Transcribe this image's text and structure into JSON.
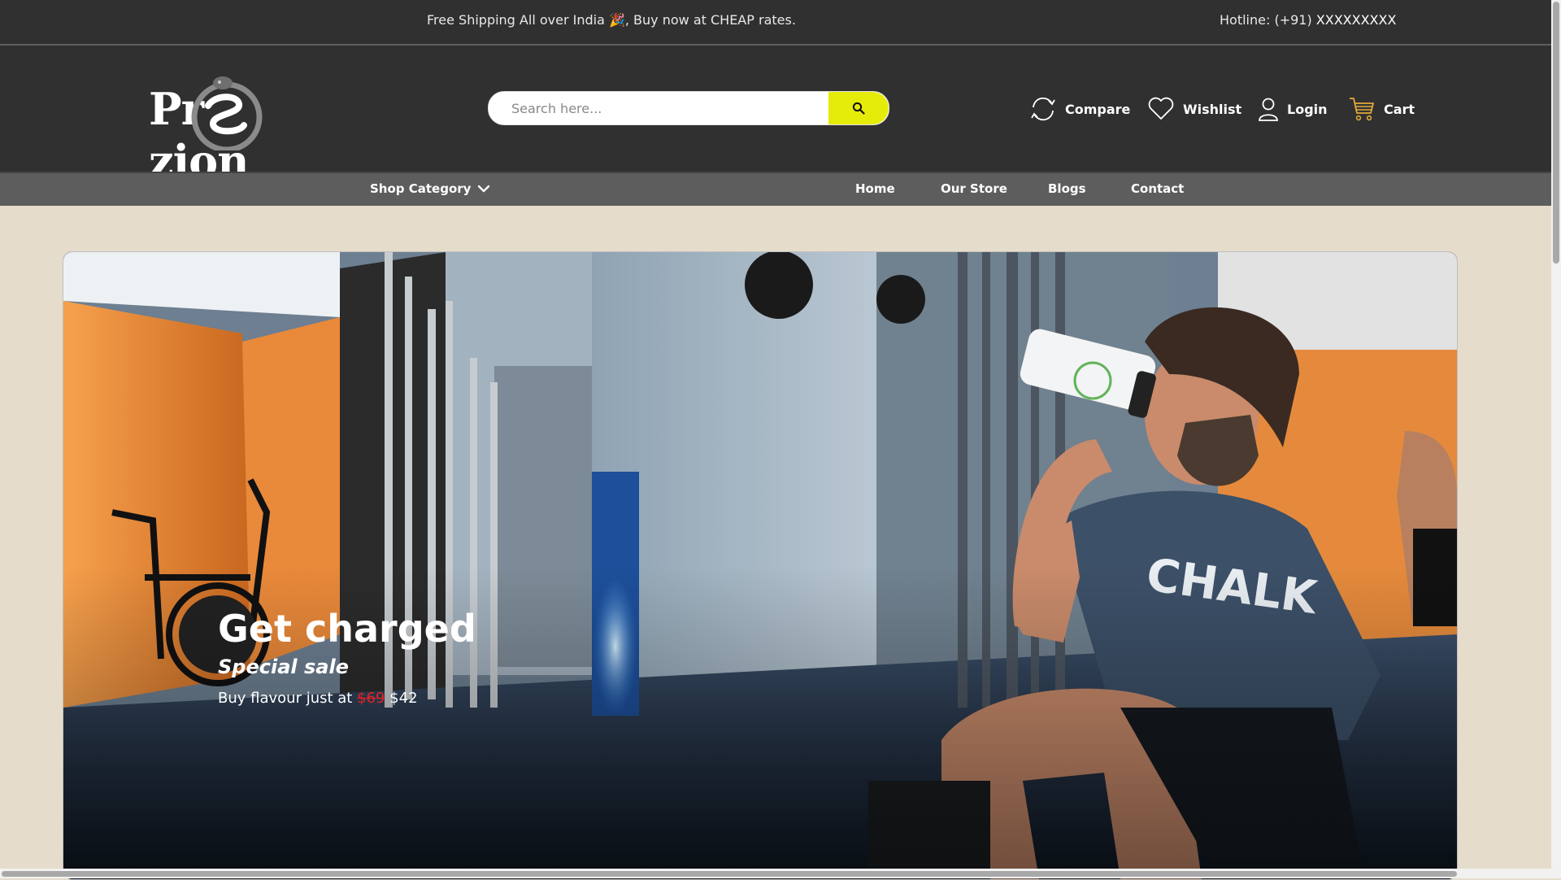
{
  "topbar": {
    "shipping_text": "Free Shipping All over India 🎉, Buy now at CHEAP rates.",
    "hotline_label": "Hotline: (+91) ",
    "hotline_number": "XXXXXXXXX"
  },
  "header": {
    "logo": {
      "left": "Pr",
      "right": "zion"
    },
    "search": {
      "placeholder": "Search here..."
    },
    "links": {
      "compare": "Compare",
      "wishlist": "Wishlist",
      "login": "Login",
      "cart": "Cart"
    }
  },
  "nav": {
    "category": "Shop Category",
    "items": [
      "Home",
      "Our Store",
      "Blogs",
      "Contact"
    ]
  },
  "hero": {
    "title": "Get charged",
    "subtitle": "Special sale",
    "buy_prefix": "Buy flavour just at ",
    "old_price": "$69",
    "new_price": "$42"
  },
  "colors": {
    "header_bg": "#303030",
    "nav_bg": "#5d5d5d",
    "page_bg": "#e6dccb",
    "search_accent": "#e6ec09",
    "old_price": "#e02323"
  }
}
